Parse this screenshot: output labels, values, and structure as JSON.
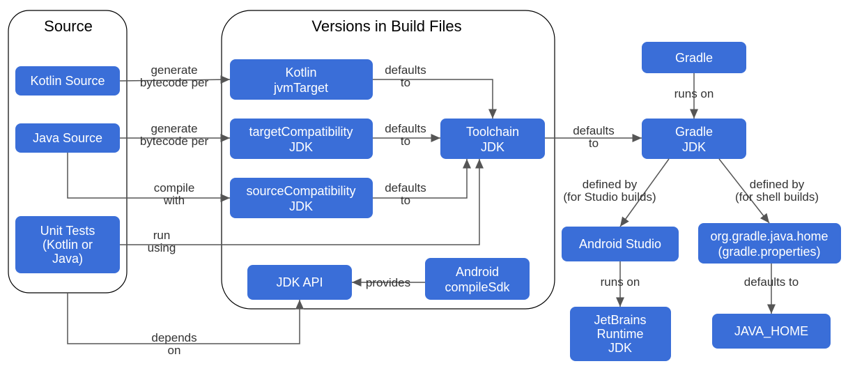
{
  "groups": {
    "source": {
      "title": "Source"
    },
    "versions": {
      "title": "Versions in Build Files"
    }
  },
  "nodes": {
    "kotlin_source": {
      "label": "Kotlin Source"
    },
    "java_source": {
      "label": "Java Source"
    },
    "unit_tests": {
      "label1": "Unit Tests",
      "label2": "(Kotlin or",
      "label3": "Java)"
    },
    "kotlin_jvmtarget": {
      "label1": "Kotlin",
      "label2": "jvmTarget"
    },
    "target_compat": {
      "label1": "targetCompatibility",
      "label2": "JDK"
    },
    "source_compat": {
      "label1": "sourceCompatibility",
      "label2": "JDK"
    },
    "jdk_api": {
      "label": "JDK API"
    },
    "compile_sdk": {
      "label1": "Android",
      "label2": "compileSdk"
    },
    "toolchain": {
      "label1": "Toolchain",
      "label2": "JDK"
    },
    "gradle": {
      "label": "Gradle"
    },
    "gradle_jdk": {
      "label1": "Gradle",
      "label2": "JDK"
    },
    "android_studio": {
      "label": "Android Studio"
    },
    "orggradle": {
      "label1": "org.gradle.java.home",
      "label2": "(gradle.properties)"
    },
    "jetbrains": {
      "label1": "JetBrains",
      "label2": "Runtime",
      "label3": "JDK"
    },
    "java_home": {
      "label": "JAVA_HOME"
    }
  },
  "edges": {
    "gen_bytecode1": {
      "l1": "generate",
      "l2": "bytecode per"
    },
    "gen_bytecode2": {
      "l1": "generate",
      "l2": "bytecode per"
    },
    "compile_with": {
      "l1": "compile",
      "l2": "with"
    },
    "run_using": {
      "l1": "run",
      "l2": "using"
    },
    "defaults_to1": {
      "l1": "defaults",
      "l2": "to"
    },
    "defaults_to2": {
      "l1": "defaults",
      "l2": "to"
    },
    "defaults_to3": {
      "l1": "defaults",
      "l2": "to"
    },
    "defaults_to4": {
      "l1": "defaults",
      "l2": "to"
    },
    "provides": {
      "l1": "provides"
    },
    "depends_on": {
      "l1": "depends",
      "l2": "on"
    },
    "runs_on1": {
      "l1": "runs on"
    },
    "runs_on2": {
      "l1": "runs on"
    },
    "defined_studio": {
      "l1": "defined by",
      "l2": "(for Studio builds)"
    },
    "defined_shell": {
      "l1": "defined by",
      "l2": "(for shell builds)"
    },
    "defaults_to5": {
      "l1": "defaults to"
    }
  }
}
